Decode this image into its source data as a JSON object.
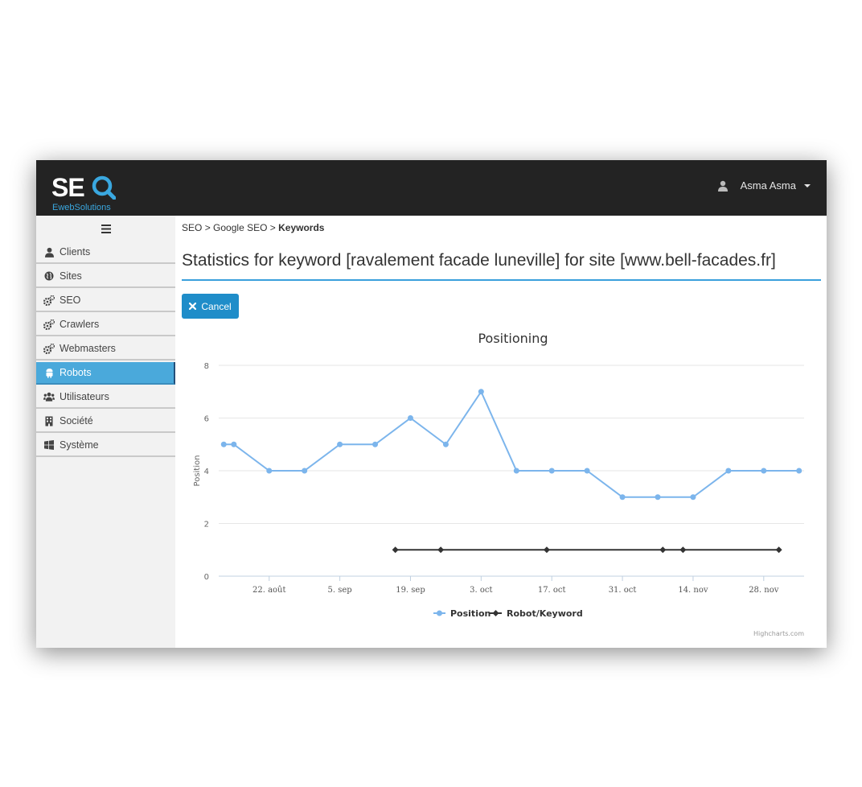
{
  "app": {
    "logo_text": "SE",
    "logo_sub": "EwebSolutions",
    "user_name": "Asma Asma"
  },
  "sidebar": {
    "items": [
      {
        "label": "Clients",
        "icon": "user-icon"
      },
      {
        "label": "Sites",
        "icon": "globe-icon"
      },
      {
        "label": "SEO",
        "icon": "gears-icon"
      },
      {
        "label": "Crawlers",
        "icon": "gears-icon"
      },
      {
        "label": "Webmasters",
        "icon": "gears-icon"
      },
      {
        "label": "Robots",
        "icon": "android-icon",
        "active": true
      },
      {
        "label": "Utilisateurs",
        "icon": "users-icon"
      },
      {
        "label": "Société",
        "icon": "building-icon"
      },
      {
        "label": "Système",
        "icon": "windows-icon"
      }
    ]
  },
  "breadcrumb": {
    "part1": "SEO",
    "sep": ">",
    "part2": "Google SEO",
    "current": "Keywords"
  },
  "page": {
    "title": "Statistics for keyword [ravalement facade luneville] for site [www.bell-facades.fr]",
    "cancel_label": "Cancel"
  },
  "colors": {
    "accent": "#3aa0dc",
    "position_series": "#7cb5ec",
    "robot_series": "#333333",
    "topbar": "#232323"
  },
  "chart_data": {
    "type": "line",
    "title": "Positioning",
    "ylabel": "Position",
    "xlabel": "",
    "ylim": [
      0,
      8
    ],
    "y_ticks": [
      0,
      2,
      4,
      6,
      8
    ],
    "x_tick_labels": [
      "22. août",
      "5. sep",
      "19. sep",
      "3. oct",
      "17. oct",
      "31. oct",
      "14. nov",
      "28. nov"
    ],
    "x_range": [
      "2015-08-12",
      "2015-12-06"
    ],
    "x_ticks": [
      "2015-08-22",
      "2015-09-05",
      "2015-09-19",
      "2015-10-03",
      "2015-10-17",
      "2015-10-31",
      "2015-11-14",
      "2015-11-28"
    ],
    "grid": true,
    "legend_position": "bottom-center",
    "credits": "Highcharts.com",
    "series": [
      {
        "name": "Position",
        "color": "#7cb5ec",
        "points": [
          {
            "x": "2015-08-13",
            "y": 5
          },
          {
            "x": "2015-08-15",
            "y": 5
          },
          {
            "x": "2015-08-22",
            "y": 4
          },
          {
            "x": "2015-08-29",
            "y": 4
          },
          {
            "x": "2015-09-05",
            "y": 5
          },
          {
            "x": "2015-09-12",
            "y": 5
          },
          {
            "x": "2015-09-19",
            "y": 6
          },
          {
            "x": "2015-09-26",
            "y": 5
          },
          {
            "x": "2015-10-03",
            "y": 7
          },
          {
            "x": "2015-10-10",
            "y": 4
          },
          {
            "x": "2015-10-17",
            "y": 4
          },
          {
            "x": "2015-10-24",
            "y": 4
          },
          {
            "x": "2015-10-31",
            "y": 3
          },
          {
            "x": "2015-11-07",
            "y": 3
          },
          {
            "x": "2015-11-14",
            "y": 3
          },
          {
            "x": "2015-11-21",
            "y": 4
          },
          {
            "x": "2015-11-28",
            "y": 4
          },
          {
            "x": "2015-12-05",
            "y": 4
          }
        ]
      },
      {
        "name": "Robot/Keyword",
        "color": "#333333",
        "points": [
          {
            "x": "2015-09-16",
            "y": 1
          },
          {
            "x": "2015-09-25",
            "y": 1
          },
          {
            "x": "2015-10-16",
            "y": 1
          },
          {
            "x": "2015-11-08",
            "y": 1
          },
          {
            "x": "2015-11-12",
            "y": 1
          },
          {
            "x": "2015-12-01",
            "y": 1
          }
        ]
      }
    ]
  }
}
